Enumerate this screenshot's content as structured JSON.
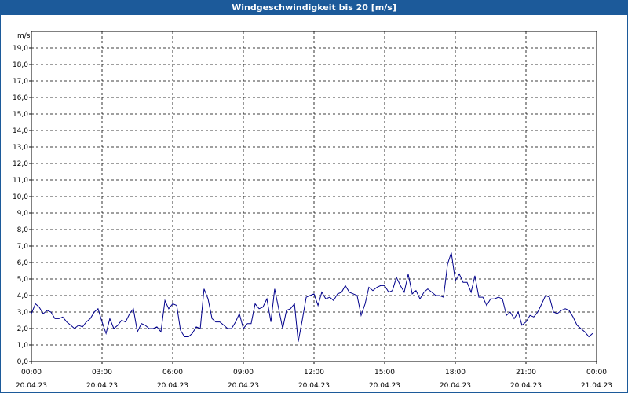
{
  "window": {
    "title": "Windgeschwindigkeit bis 20 [m/s]"
  },
  "chart_data": {
    "type": "line",
    "title": "Windgeschwindigkeit bis 20 [m/s]",
    "ylabel": "m/s",
    "xlabel": "",
    "ylim": [
      0,
      20
    ],
    "xlim_hours": [
      0,
      24
    ],
    "grid": true,
    "grid_style": "dashed",
    "colors": {
      "line": "#00008b",
      "grid": "#000000",
      "title_bg": "#1c5a9a"
    },
    "y_ticks": [
      "0,0",
      "1,0",
      "2,0",
      "3,0",
      "4,0",
      "5,0",
      "6,0",
      "7,0",
      "8,0",
      "9,0",
      "10,0",
      "11,0",
      "12,0",
      "13,0",
      "14,0",
      "15,0",
      "16,0",
      "17,0",
      "18,0",
      "19,0"
    ],
    "x_ticks": [
      {
        "time": "00:00",
        "date": "20.04.23"
      },
      {
        "time": "03:00",
        "date": "20.04.23"
      },
      {
        "time": "06:00",
        "date": "20.04.23"
      },
      {
        "time": "09:00",
        "date": "20.04.23"
      },
      {
        "time": "12:00",
        "date": "20.04.23"
      },
      {
        "time": "15:00",
        "date": "20.04.23"
      },
      {
        "time": "18:00",
        "date": "20.04.23"
      },
      {
        "time": "21:00",
        "date": "20.04.23"
      },
      {
        "time": "00:00",
        "date": "21.04.23"
      }
    ],
    "series": [
      {
        "x_hours": [
          0.0,
          0.17,
          0.33,
          0.5,
          0.67,
          0.83,
          1.0,
          1.17,
          1.33,
          1.5,
          1.67,
          1.83,
          2.0,
          2.17,
          2.33,
          2.5,
          2.67,
          2.83,
          3.0,
          3.17,
          3.33,
          3.5,
          3.67,
          3.83,
          4.0,
          4.17,
          4.33,
          4.5,
          4.67,
          4.83,
          5.0,
          5.17,
          5.33,
          5.5,
          5.67,
          5.83,
          6.0,
          6.17,
          6.33,
          6.5,
          6.67,
          6.83,
          7.0,
          7.17,
          7.33,
          7.5,
          7.67,
          7.83,
          8.0,
          8.17,
          8.33,
          8.5,
          8.67,
          8.83,
          9.0,
          9.17,
          9.33,
          9.5,
          9.67,
          9.83,
          10.0,
          10.17,
          10.33,
          10.5,
          10.67,
          10.83,
          11.0,
          11.17,
          11.33,
          11.5,
          11.67,
          11.83,
          12.0,
          12.17,
          12.33,
          12.5,
          12.67,
          12.83,
          13.0,
          13.17,
          13.33,
          13.5,
          13.67,
          13.83,
          14.0,
          14.17,
          14.33,
          14.5,
          14.67,
          14.83,
          15.0,
          15.17,
          15.33,
          15.5,
          15.67,
          15.83,
          16.0,
          16.17,
          16.33,
          16.5,
          16.67,
          16.83,
          17.0,
          17.17,
          17.33,
          17.5,
          17.67,
          17.83,
          18.0,
          18.17,
          18.33,
          18.5,
          18.67,
          18.83,
          19.0,
          19.17,
          19.33,
          19.5,
          19.67,
          19.83,
          20.0,
          20.17,
          20.33,
          20.5,
          20.67,
          20.83,
          21.0,
          21.17,
          21.33,
          21.5,
          21.67,
          21.83,
          22.0,
          22.17,
          22.33,
          22.5,
          22.67,
          22.83,
          23.0,
          23.17,
          23.33,
          23.5,
          23.67,
          23.83
        ],
        "y": [
          2.9,
          3.5,
          3.3,
          2.9,
          3.1,
          3.0,
          2.6,
          2.6,
          2.7,
          2.4,
          2.2,
          2.0,
          2.2,
          2.1,
          2.4,
          2.6,
          3.0,
          3.2,
          2.4,
          1.7,
          2.6,
          2.0,
          2.2,
          2.5,
          2.4,
          2.9,
          3.2,
          1.8,
          2.3,
          2.2,
          2.0,
          2.0,
          2.1,
          1.8,
          3.7,
          3.2,
          3.5,
          3.4,
          1.9,
          1.5,
          1.5,
          1.7,
          2.1,
          2.0,
          4.4,
          3.8,
          2.6,
          2.4,
          2.4,
          2.2,
          2.0,
          2.0,
          2.4,
          2.9,
          2.0,
          2.3,
          2.3,
          3.5,
          3.2,
          3.3,
          3.8,
          2.4,
          4.4,
          3.2,
          2.0,
          3.1,
          3.2,
          3.5,
          1.2,
          2.5,
          3.9,
          4.0,
          4.1,
          3.4,
          4.2,
          3.8,
          3.9,
          3.7,
          4.1,
          4.2,
          4.6,
          4.2,
          4.1,
          4.0,
          2.8,
          3.5,
          4.5,
          4.3,
          4.5,
          4.6,
          4.6,
          4.2,
          4.3,
          5.1,
          4.6,
          4.2,
          5.3,
          4.1,
          4.3,
          3.8,
          4.2,
          4.4,
          4.2,
          4.0,
          4.0,
          3.9,
          5.9,
          6.6,
          4.9,
          5.3,
          4.8,
          4.8,
          4.2,
          5.2,
          3.9,
          3.9,
          3.4,
          3.8,
          3.8,
          3.9,
          3.8,
          2.8,
          3.0,
          2.6,
          3.0,
          2.2,
          2.4,
          2.8,
          2.7,
          3.0,
          3.5,
          4.0,
          3.9,
          3.0,
          2.9,
          3.1,
          3.2,
          3.1,
          2.7,
          2.2,
          2.0,
          1.8,
          1.5,
          1.7
        ]
      }
    ]
  }
}
